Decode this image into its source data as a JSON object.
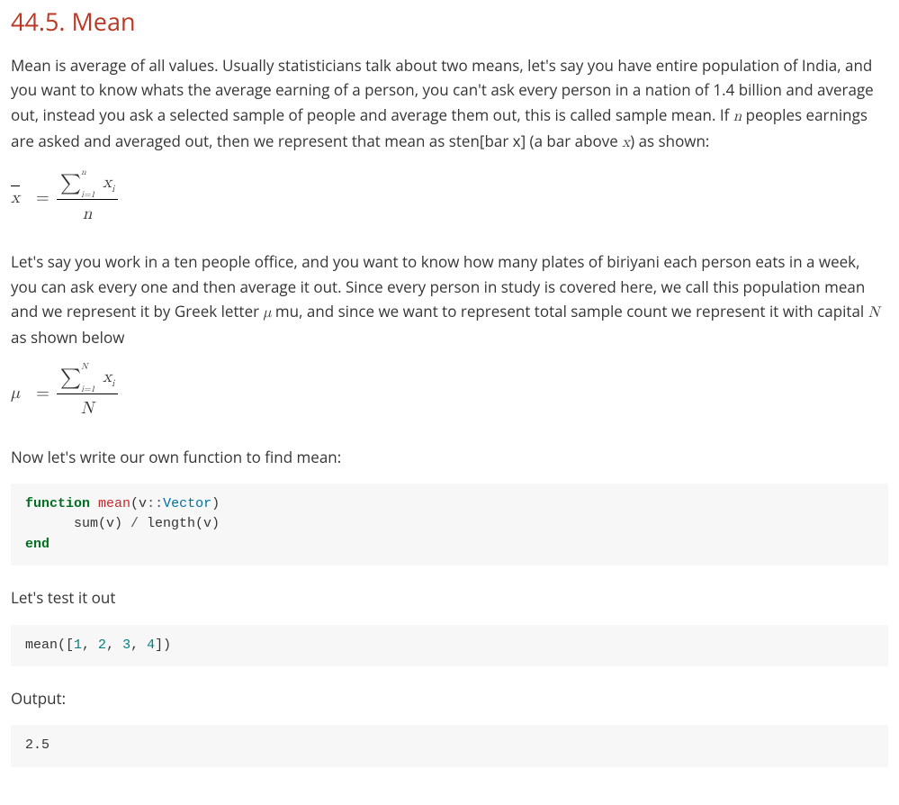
{
  "heading": "44.5. Mean",
  "paragraphs": {
    "p1_a": "Mean is average of all values. Usually statisticians talk about two means, let's say you have entire population of India, and you want to know whats the average earning of a person, you can't ask every person in a nation of 1.4 billion and average out, instead you ask a selected sample of people and average them out, this is called sample mean. If ",
    "p1_var_n": "n",
    "p1_b": " peoples earnings are asked and averaged out, then we represent that mean as sten[bar x] (a bar above ",
    "p1_var_x": "x",
    "p1_c": ") as shown:",
    "p2_a": "Let's say you work in a ten people office, and you want to know how many plates of biriyani each person eats in a week, you can ask every one and then average it out. Since every person in study is covered here, we call this population mean and we represent it by Greek letter ",
    "p2_var_mu": "μ",
    "p2_b": " mu, and since we want to represent total sample count we represent it with capital ",
    "p2_var_N": "N",
    "p2_c": " as shown below",
    "p3": "Now let's write our own function to find mean:",
    "p4": "Let's test it out",
    "p5": "Output:"
  },
  "formulas": {
    "f1": {
      "lhs_xbar": "x",
      "eq": "=",
      "sigma": "∑",
      "sup": "n",
      "sub": "i=1",
      "term_base": "x",
      "term_sub": "i",
      "den": "n"
    },
    "f2": {
      "lhs_mu": "μ",
      "eq": "=",
      "sigma": "∑",
      "sup": "N",
      "sub": "i=1",
      "term_base": "x",
      "term_sub": "i",
      "den": "N"
    }
  },
  "code": {
    "c1": {
      "kw_function": "function",
      "fn_name": "mean",
      "open": "(v",
      "colon": "::",
      "type": "Vector",
      "close": ")",
      "indent": "      ",
      "body_a": "sum(v) ",
      "op": "/",
      "body_b": " length(v)",
      "kw_end": "end"
    },
    "c2": {
      "call": "mean([",
      "n1": "1",
      "s1": ", ",
      "n2": "2",
      "s2": ", ",
      "n3": "3",
      "s3": ", ",
      "n4": "4",
      "close": "])"
    },
    "c3": {
      "out": "2.5"
    }
  }
}
